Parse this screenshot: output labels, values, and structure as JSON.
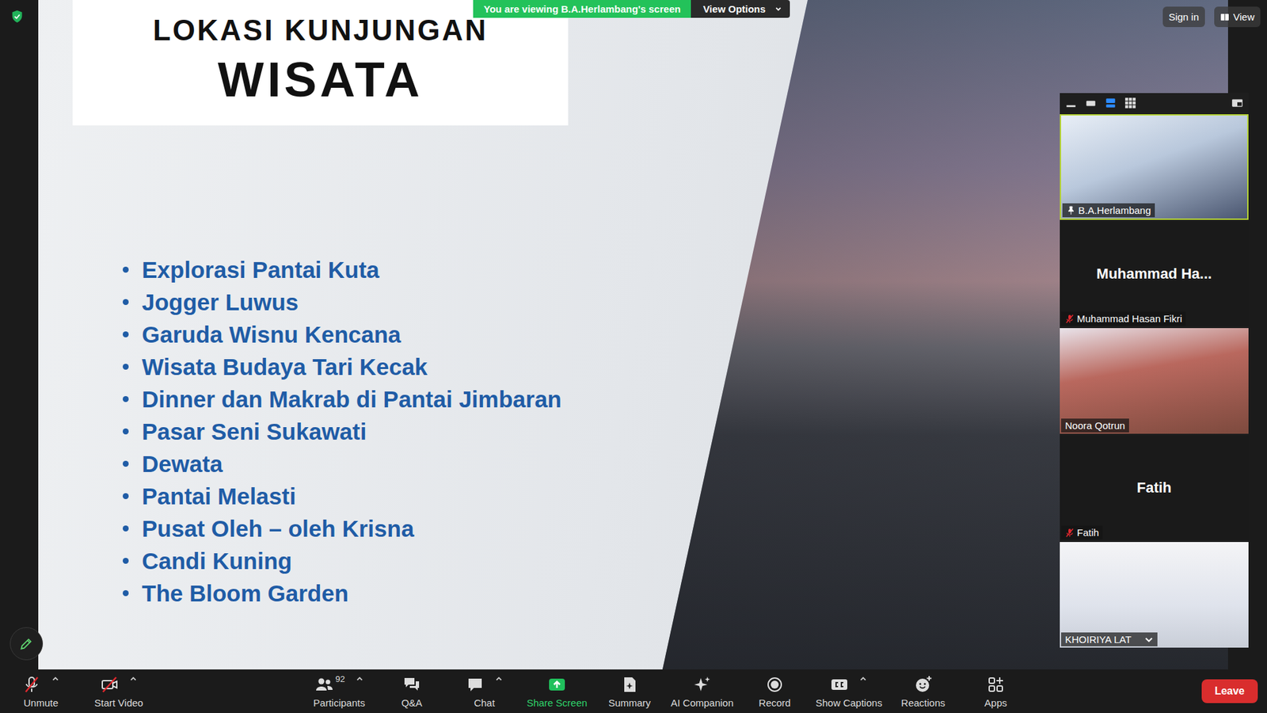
{
  "banner": {
    "text": "You are viewing B.A.Herlambang's screen",
    "button": "View Options"
  },
  "top_right": [
    "Sign in",
    "View"
  ],
  "slide": {
    "title": "LOKASI KUNJUNGAN",
    "subtitle": "WISATA",
    "items": [
      "Explorasi Pantai Kuta",
      "Jogger Luwus",
      "Garuda Wisnu Kencana",
      "Wisata Budaya Tari Kecak",
      "Dinner dan Makrab di Pantai Jimbaran",
      "Pasar Seni Sukawati",
      "Dewata",
      "Pantai Melasti",
      "Pusat Oleh – oleh Krisna",
      "Candi Kuning",
      "The Bloom Garden"
    ]
  },
  "panel": {
    "view_modes": [
      {
        "kind": "minimize",
        "selected": false
      },
      {
        "kind": "thumbnail",
        "selected": false
      },
      {
        "kind": "speaker",
        "selected": true
      },
      {
        "kind": "gallery",
        "selected": false
      }
    ],
    "tiles": [
      {
        "kind": "video",
        "label": "B.A.Herlambang",
        "display": "",
        "muted": false,
        "pinned": true,
        "active": true
      },
      {
        "kind": "avatar",
        "label": "Muhammad Hasan Fikri",
        "display": "Muhammad Ha...",
        "muted": true,
        "pinned": false,
        "active": false
      },
      {
        "kind": "video",
        "label": "Noora Qotrun",
        "display": "",
        "muted": false,
        "pinned": false,
        "active": false
      },
      {
        "kind": "avatar",
        "label": "Fatih",
        "display": "Fatih",
        "muted": true,
        "pinned": false,
        "active": false
      },
      {
        "kind": "video",
        "label": "KHOIRIYA LAT",
        "display": "",
        "muted": false,
        "pinned": false,
        "active": false
      }
    ]
  },
  "toolbar": {
    "left": [
      {
        "kind": "mic",
        "label": "Unmute",
        "off": true,
        "menu": true
      },
      {
        "kind": "video",
        "label": "Start Video",
        "off": true,
        "menu": true
      }
    ],
    "center": [
      {
        "kind": "participants",
        "label": "Participants",
        "count": "92",
        "menu": true,
        "highlight": false
      },
      {
        "kind": "qa",
        "label": "Q&A",
        "count": "",
        "menu": false,
        "highlight": false
      },
      {
        "kind": "chat",
        "label": "Chat",
        "count": "",
        "menu": true,
        "highlight": false
      },
      {
        "kind": "share",
        "label": "Share Screen",
        "count": "",
        "menu": false,
        "highlight": true
      },
      {
        "kind": "summary",
        "label": "Summary",
        "count": "",
        "menu": false,
        "highlight": false
      },
      {
        "kind": "ai",
        "label": "AI Companion",
        "count": "",
        "menu": false,
        "highlight": false
      },
      {
        "kind": "record",
        "label": "Record",
        "count": "",
        "menu": false,
        "highlight": false
      },
      {
        "kind": "captions",
        "label": "Show Captions",
        "count": "",
        "menu": true,
        "highlight": false
      },
      {
        "kind": "reactions",
        "label": "Reactions",
        "count": "",
        "menu": false,
        "highlight": false
      },
      {
        "kind": "apps",
        "label": "Apps",
        "count": "",
        "menu": false,
        "highlight": false
      }
    ],
    "leave": "Leave"
  }
}
